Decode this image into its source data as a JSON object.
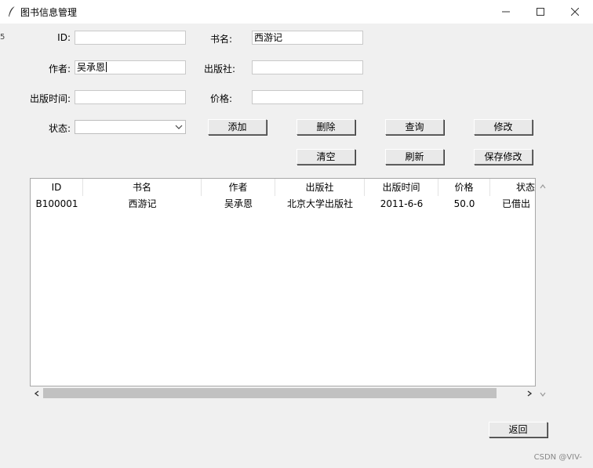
{
  "window": {
    "title": "图书信息管理",
    "icon": "feather-icon"
  },
  "form": {
    "id_label": "ID:",
    "id_value": "",
    "title_label": "书名:",
    "title_value": "西游记",
    "author_label": "作者:",
    "author_value": "吴承恩",
    "publisher_label": "出版社:",
    "publisher_value": "",
    "pubdate_label": "出版时间:",
    "pubdate_value": "",
    "price_label": "价格:",
    "price_value": "",
    "status_label": "状态:",
    "status_value": ""
  },
  "buttons": {
    "add": "添加",
    "delete": "删除",
    "query": "查询",
    "modify": "修改",
    "clear": "清空",
    "refresh": "刷新",
    "save": "保存修改",
    "back": "返回"
  },
  "table": {
    "columns": [
      "ID",
      "书名",
      "作者",
      "出版社",
      "出版时间",
      "价格",
      "状态"
    ],
    "rows": [
      [
        "B100001",
        "西游记",
        "吴承恩",
        "北京大学出版社",
        "2011-6-6",
        "50.0",
        "已借出"
      ]
    ]
  },
  "edge_mark": "5",
  "watermark": "CSDN @VIV-"
}
